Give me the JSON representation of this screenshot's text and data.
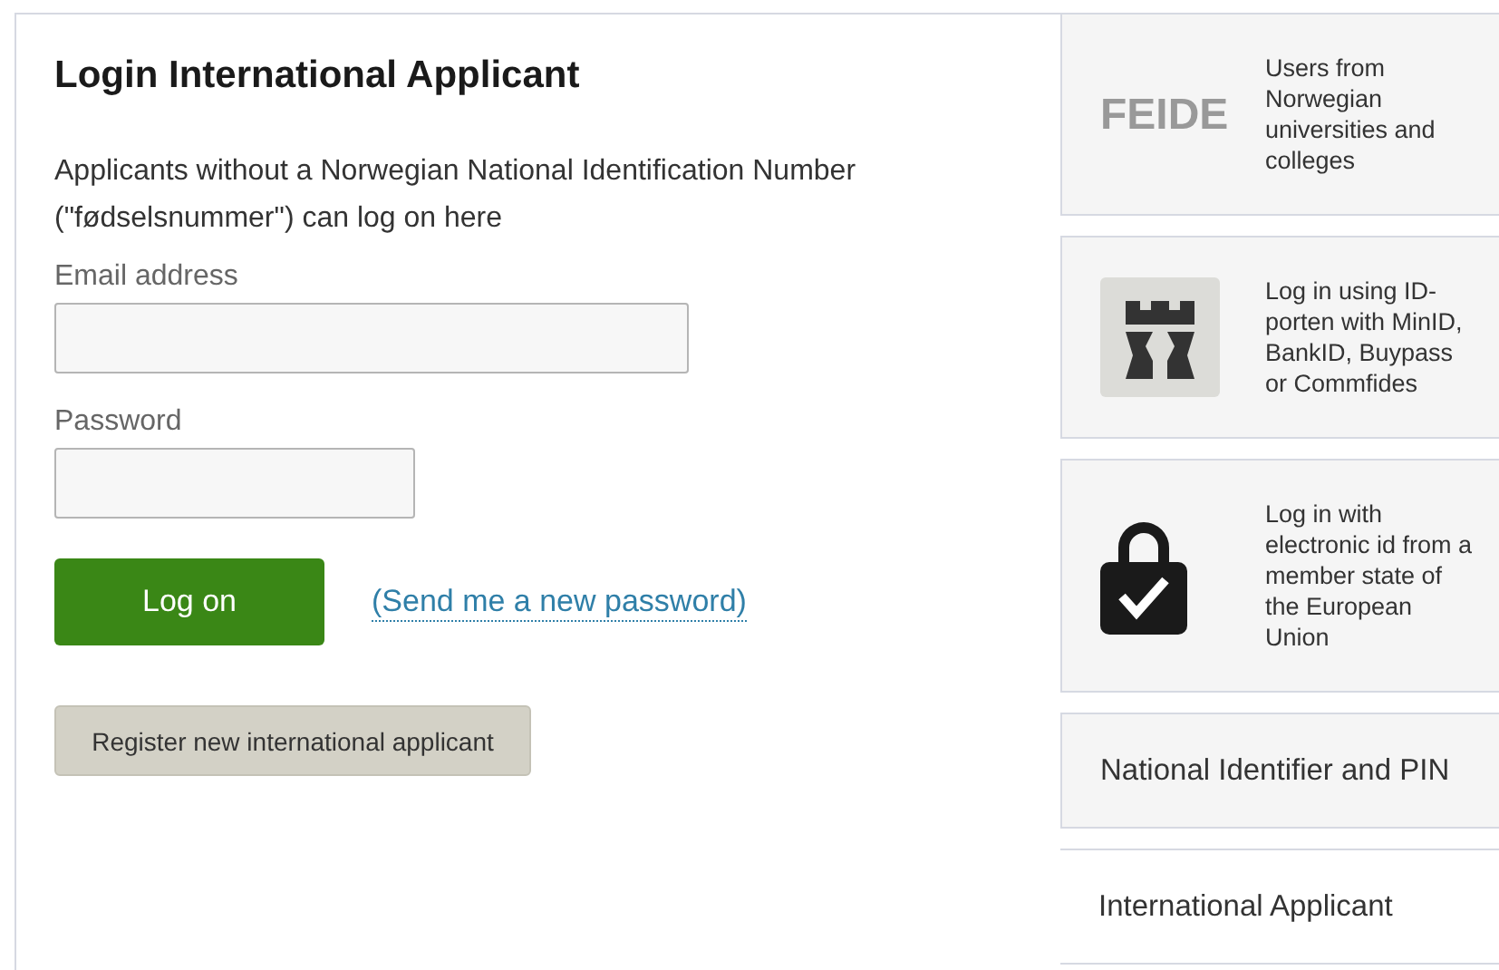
{
  "main": {
    "title": "Login International Applicant",
    "intro": "Applicants without a Norwegian National Identification Number (\"fødselsnummer\") can log on here",
    "fields": [
      {
        "label": "Email address",
        "kind": "wide"
      },
      {
        "label": "Password",
        "kind": "narrow"
      }
    ],
    "log_on_button": "Log on",
    "reset_link": "(Send me a new password)",
    "register_button": "Register new international applicant"
  },
  "methods": [
    {
      "kind": "feide",
      "logo_text": "FEIDE",
      "text": "Users from Norwegian universities and colleges",
      "selected": false
    },
    {
      "kind": "idporten",
      "text": "Log in using ID-porten with MinID, BankID, Buypass or Commfides",
      "selected": false
    },
    {
      "kind": "eid",
      "text": "Log in with electronic id from a member state of the European Union",
      "selected": false
    },
    {
      "kind": "text",
      "text": "National Identifier and PIN",
      "selected": false
    },
    {
      "kind": "text",
      "text": "International Applicant",
      "selected": true
    }
  ]
}
